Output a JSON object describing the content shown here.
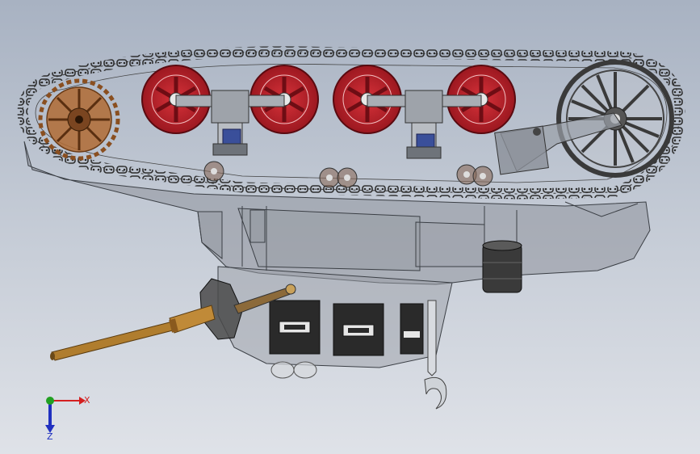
{
  "viewport": {
    "background_top": "#a8b2c2",
    "background_bottom": "#dfe2e8"
  },
  "model": {
    "components": [
      {
        "name": "track-chain",
        "color": "#3c3c3c"
      },
      {
        "name": "drive-sprocket",
        "color": "#a8642e"
      },
      {
        "name": "road-wheel",
        "color": "#b51f27",
        "count": 4
      },
      {
        "name": "idler-wheel",
        "color": "#444444"
      },
      {
        "name": "suspension-spring",
        "color": "#3a4f9a",
        "count": 2
      },
      {
        "name": "return-roller",
        "count": 5
      },
      {
        "name": "hull-body",
        "color": "#8f949c"
      },
      {
        "name": "gun-barrel",
        "color": "#b07d2e"
      },
      {
        "name": "drum-canister",
        "color": "#3a3a3a"
      },
      {
        "name": "ammo-box",
        "color": "#2a2a2a",
        "count": 3
      }
    ]
  },
  "triad": {
    "x_label": "X",
    "z_label": "Z",
    "x_color": "#d42020",
    "y_color": "#22a022",
    "z_color": "#2030c0"
  }
}
